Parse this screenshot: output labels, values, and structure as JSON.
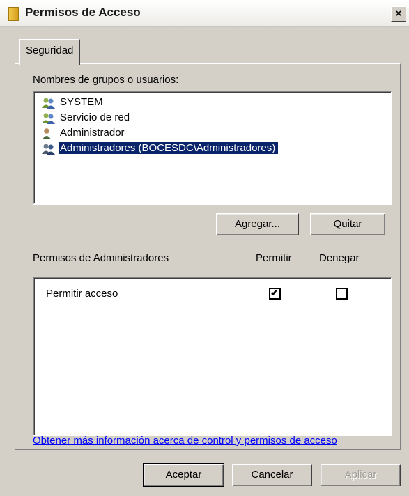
{
  "window": {
    "title": "Permisos de Acceso",
    "close_label": "×"
  },
  "tabs": [
    {
      "label": "Seguridad"
    }
  ],
  "users": {
    "label": "Nombres de grupos o usuarios:",
    "items": [
      {
        "label": "SYSTEM",
        "icon": "group-users-icon",
        "selected": false
      },
      {
        "label": "Servicio de red",
        "icon": "group-users-icon",
        "selected": false
      },
      {
        "label": "Administrador",
        "icon": "user-icon",
        "selected": false
      },
      {
        "label": "Administradores (BOCESDC\\Administradores)",
        "icon": "group-users-icon",
        "selected": true
      }
    ],
    "add_button": "Agregar...",
    "remove_button": "Quitar"
  },
  "permissions": {
    "title": "Permisos de Administradores",
    "allow_header": "Permitir",
    "deny_header": "Denegar",
    "rows": [
      {
        "label": "Permitir acceso",
        "allow": true,
        "deny": false
      }
    ]
  },
  "help_link": "Obtener más información acerca de control y permisos de acceso",
  "footer": {
    "ok": "Aceptar",
    "cancel": "Cancelar",
    "apply": "Aplicar"
  },
  "colors": {
    "selection": "#0a246a",
    "face": "#d4d0c8",
    "link": "#0000ff"
  }
}
